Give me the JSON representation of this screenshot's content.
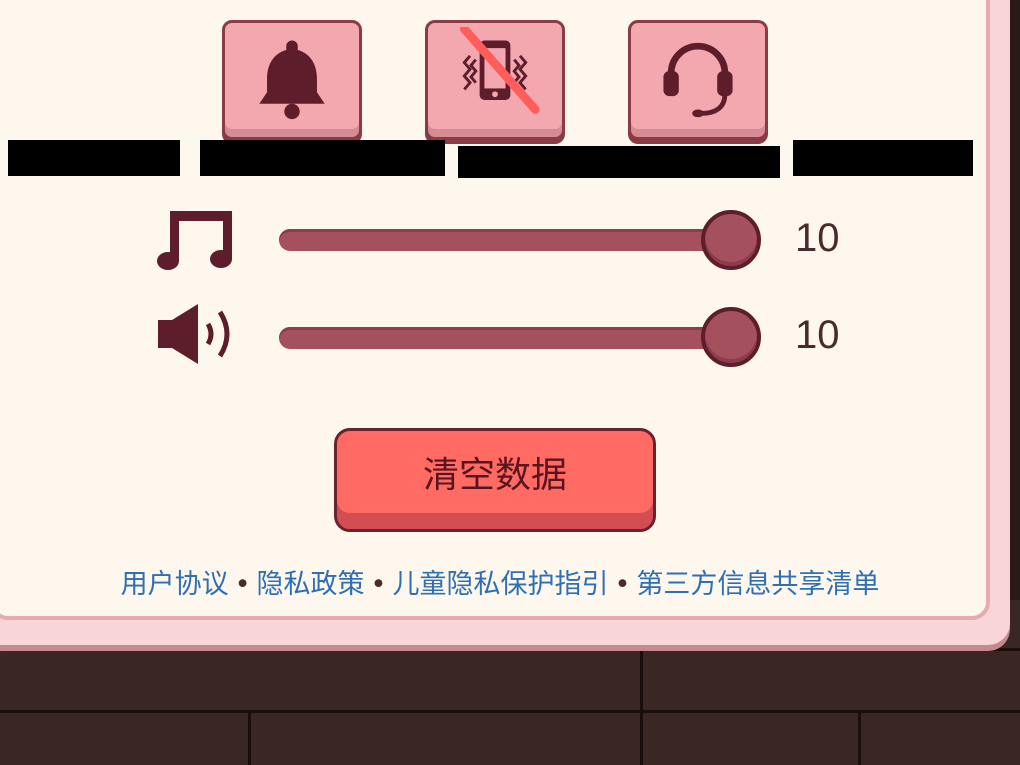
{
  "mode_tiles": [
    {
      "icon": "bell-icon",
      "state": "active"
    },
    {
      "icon": "vibrate-off-icon",
      "state": "off"
    },
    {
      "icon": "headset-icon",
      "state": "active"
    }
  ],
  "sliders": {
    "music": {
      "icon": "music-note-icon",
      "value": "10",
      "level": 1.0
    },
    "sound": {
      "icon": "speaker-icon",
      "value": "10",
      "level": 1.0
    }
  },
  "clear_button": {
    "label": "清空数据"
  },
  "footer": {
    "user_agreement": "用户协议",
    "privacy_policy": "隐私政策",
    "children_privacy": "儿童隐私保护指引",
    "third_party": "第三方信息共享清单",
    "separator": "•"
  },
  "colors": {
    "panel": "#fdf7ee",
    "tile": "#f3a7af",
    "slider": "#a4505e",
    "button": "#ff6a63",
    "link": "#2f6fb4"
  }
}
